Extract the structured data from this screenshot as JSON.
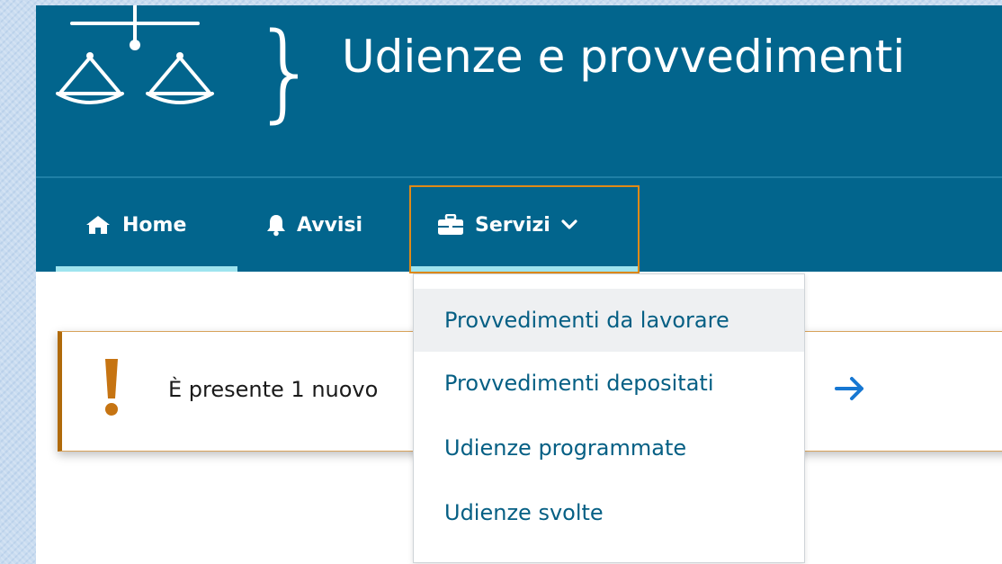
{
  "header": {
    "title": "Udienze e provvedimenti",
    "brace": "}"
  },
  "nav": {
    "items": [
      {
        "label": "Home",
        "icon": "home-icon",
        "active": true
      },
      {
        "label": "Avvisi",
        "icon": "bell-icon"
      },
      {
        "label": "Servizi",
        "icon": "briefcase-icon",
        "expanded": true
      }
    ]
  },
  "dropdown": {
    "items": [
      {
        "label": "Provvedimenti da lavorare",
        "hovered": true
      },
      {
        "label": "Provvedimenti depositati"
      },
      {
        "label": "Udienze programmate"
      },
      {
        "label": "Udienze svolte"
      }
    ]
  },
  "alert": {
    "text": "È presente 1 nuovo",
    "icon": "exclamation-icon",
    "action_icon": "arrow-right-icon"
  },
  "colors": {
    "header_bg": "#02658d",
    "active_underline": "#9ee4ef",
    "focus_outline": "#e08a16",
    "alert_accent": "#b06a0a",
    "link_text": "#055f84",
    "arrow": "#1677d2"
  }
}
